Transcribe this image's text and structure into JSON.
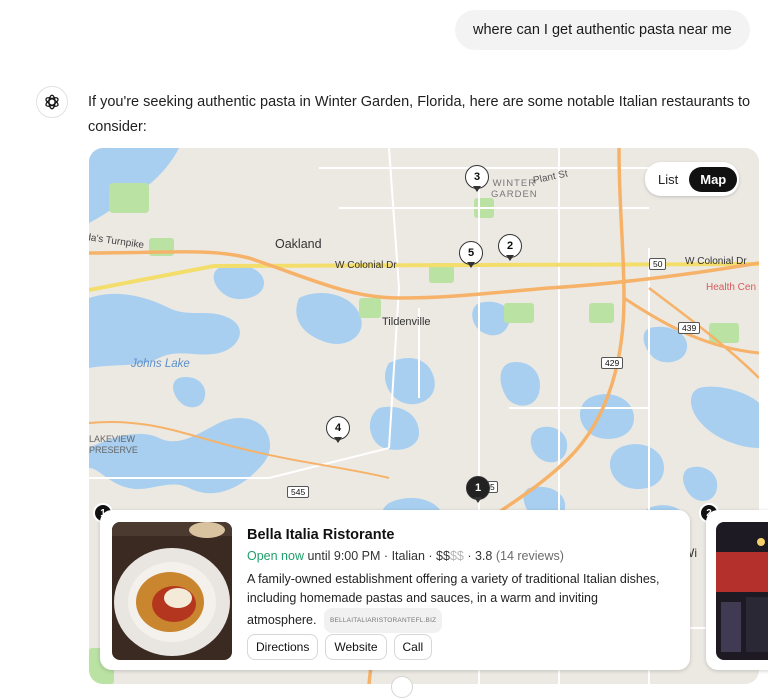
{
  "user_message": "where can I get authentic pasta near me",
  "assistant": {
    "icon": "openai-logo-icon",
    "intro": "If you're seeking authentic pasta in Winter Garden, Florida, here are some notable Italian restaurants to consider:"
  },
  "map": {
    "view_toggle": {
      "list_label": "List",
      "map_label": "Map",
      "active": "Map"
    },
    "place_labels": {
      "winter_garden_1": "WINTER",
      "winter_garden_2": "GARDEN",
      "plant_st": "Plant St",
      "turnpike": "da's Turnpike",
      "oakland": "Oakland",
      "colonial_w": "W Colonial Dr",
      "colonial_e": "W Colonial Dr",
      "health": "Health Cen",
      "tildenville": "Tildenville",
      "johns_lake": "Johns Lake",
      "lakeview_1": "LAKEVIEW",
      "lakeview_2": "PRESERVE",
      "road_50": "50",
      "road_439": "439",
      "road_429": "429",
      "road_545": "545",
      "road_5": "5",
      "wi": "Wi"
    },
    "pins": [
      "1",
      "2",
      "3",
      "4",
      "5"
    ]
  },
  "restaurants": [
    {
      "number": "1",
      "name": "Bella Italia Ristorante",
      "status": "Open now",
      "hours": "until 9:00 PM",
      "cuisine": "Italian",
      "price_active": "$$",
      "price_inactive": "$$",
      "rating": "3.8",
      "reviews": "(14 reviews)",
      "description": "A family-owned establishment offering a variety of traditional Italian dishes, including homemade pastas and sauces, in a warm and inviting atmosphere.",
      "website_chip": "BELLAITALIARISTORANTEFL.BIZ",
      "buttons": {
        "directions": "Directions",
        "website": "Website",
        "call": "Call"
      }
    },
    {
      "number": "2"
    }
  ],
  "colors": {
    "water": "#a8cff0",
    "land": "#ece9e3",
    "road_major": "#f6b268",
    "road_colonial": "#f3dd6b",
    "park": "#b9e2a3",
    "open_green": "#1f9e6a"
  }
}
